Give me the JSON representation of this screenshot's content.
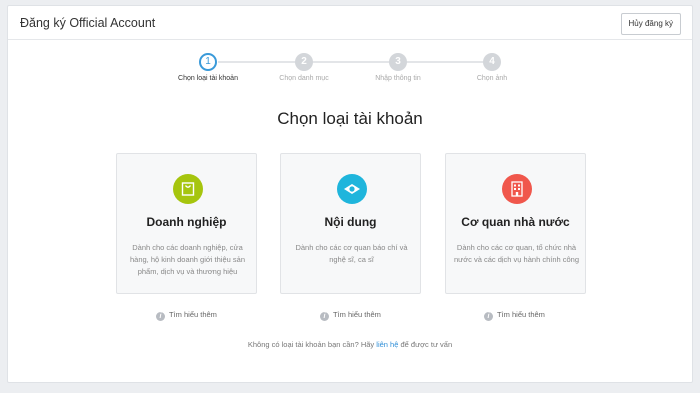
{
  "header": {
    "title": "Đăng ký Official Account",
    "cancel_label": "Hủy đăng ký"
  },
  "steps": [
    {
      "number": "1",
      "label": "Chọn loại tài khoản",
      "active": true
    },
    {
      "number": "2",
      "label": "Chọn danh mục",
      "active": false
    },
    {
      "number": "3",
      "label": "Nhập thông tin",
      "active": false
    },
    {
      "number": "4",
      "label": "Chọn ảnh",
      "active": false
    }
  ],
  "main": {
    "heading": "Chọn loại tài khoản"
  },
  "cards": [
    {
      "title": "Doanh nghiệp",
      "description": "Dành cho các doanh nghiệp, cửa hàng, hộ kinh doanh giới thiệu sản phẩm, dịch vụ và thương hiệu",
      "icon": "shopping-bag-icon",
      "color": "#a6c50e",
      "learn_more": "Tìm hiểu thêm"
    },
    {
      "title": "Nội dung",
      "description": "Dành cho các cơ quan báo chí và nghệ sĩ, ca sĩ",
      "icon": "content-icon",
      "color": "#1fb5dc",
      "learn_more": "Tìm hiểu thêm"
    },
    {
      "title": "Cơ quan nhà nước",
      "description": "Dành cho các cơ quan, tổ chức nhà nước và các dịch vụ hành chính công",
      "icon": "building-icon",
      "color": "#f0574c",
      "learn_more": "Tìm hiểu thêm"
    }
  ],
  "footer": {
    "text_before": "Không có loại tài khoản bạn cần? Hãy",
    "link": "liên hệ",
    "text_after": "để được tư vấn"
  },
  "colors": {
    "accent": "#3a9ad9",
    "link": "#2f8fd8"
  }
}
